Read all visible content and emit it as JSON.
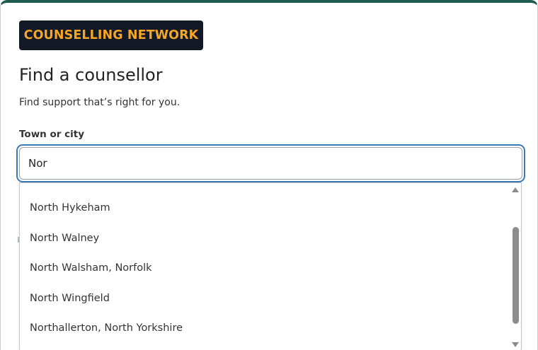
{
  "brand": {
    "logo_text": "COUNSELLING NETWORK",
    "colors": {
      "logo_bg": "#121826",
      "logo_text": "#f5a623",
      "accent": "#1f5c50",
      "focus": "#3d79b8"
    }
  },
  "page": {
    "title": "Find a counsellor",
    "subtitle": "Find support that’s right for you."
  },
  "search": {
    "label": "Town or city",
    "value": "Nor"
  },
  "dropdown": {
    "options": [
      "North Hykeham",
      "North Walney",
      "North Walsham, Norfolk",
      "North Wingfield",
      "Northallerton, North Yorkshire"
    ],
    "scrollbar": {
      "up_icon": "triangle-up",
      "down_icon": "triangle-down"
    }
  }
}
